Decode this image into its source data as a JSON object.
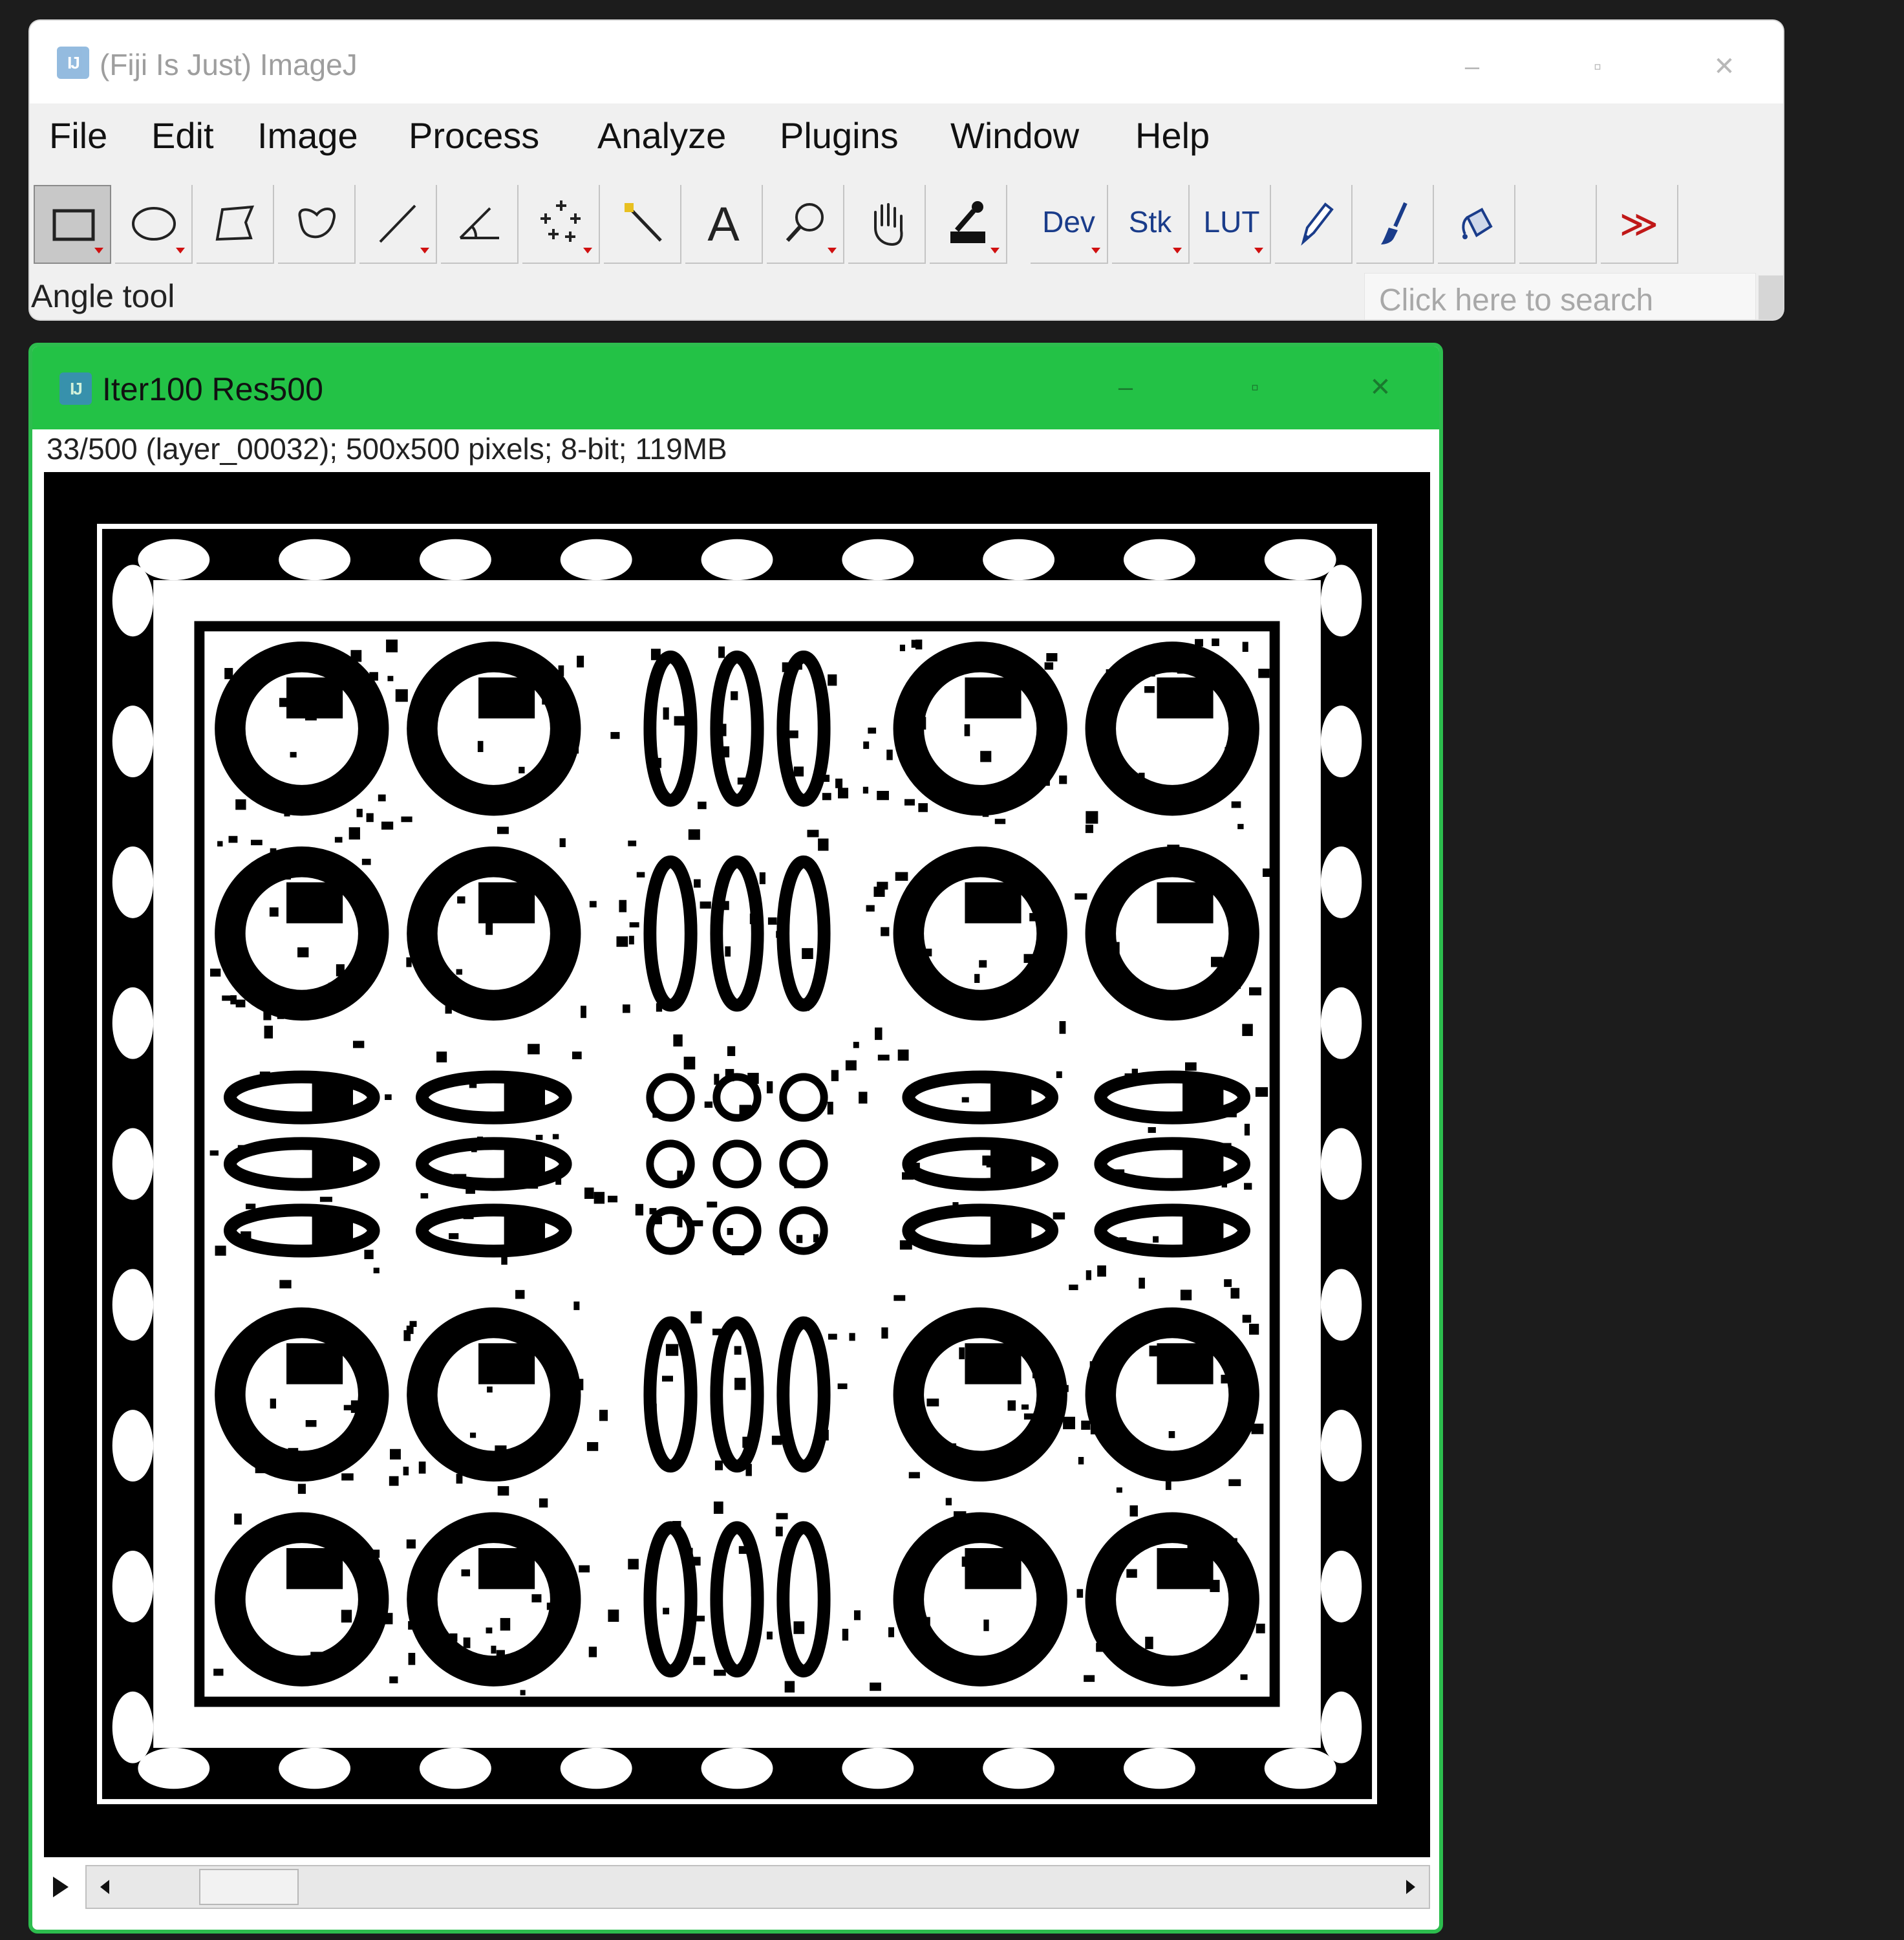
{
  "main_window": {
    "title": "(Fiji Is Just) ImageJ",
    "icon": "imagej-logo-icon",
    "controls": {
      "minimize": "–",
      "maximize": "▫",
      "close": "✕"
    }
  },
  "menubar": {
    "items": [
      "File",
      "Edit",
      "Image",
      "Process",
      "Analyze",
      "Plugins",
      "Window",
      "Help"
    ]
  },
  "toolbar": {
    "tools": [
      {
        "name": "rectangle",
        "icon": "rectangle-icon",
        "selected": true,
        "dropdown": true
      },
      {
        "name": "oval",
        "icon": "oval-icon",
        "dropdown": true
      },
      {
        "name": "polygon",
        "icon": "polygon-icon"
      },
      {
        "name": "freehand",
        "icon": "freehand-icon"
      },
      {
        "name": "line",
        "icon": "line-icon",
        "dropdown": true
      },
      {
        "name": "angle",
        "icon": "angle-icon"
      },
      {
        "name": "multipoint",
        "icon": "multipoint-icon",
        "dropdown": true
      },
      {
        "name": "wand",
        "icon": "wand-icon"
      },
      {
        "name": "text",
        "icon": "text-icon",
        "label": "A"
      },
      {
        "name": "zoom",
        "icon": "magnifier-icon",
        "dropdown": true
      },
      {
        "name": "hand",
        "icon": "hand-icon"
      },
      {
        "name": "color-picker",
        "icon": "eyedropper-icon",
        "dropdown": true
      },
      {
        "name": "dev",
        "label": "Dev",
        "dropdown": true
      },
      {
        "name": "stk",
        "label": "Stk",
        "dropdown": true
      },
      {
        "name": "lut",
        "label": "LUT",
        "dropdown": true
      },
      {
        "name": "pencil",
        "icon": "pencil-icon"
      },
      {
        "name": "brush",
        "icon": "brush-icon"
      },
      {
        "name": "flood-fill",
        "icon": "bucket-icon"
      },
      {
        "name": "empty",
        "icon": ""
      },
      {
        "name": "more",
        "label": "≫"
      }
    ]
  },
  "status": {
    "text": "Angle tool"
  },
  "search": {
    "placeholder": "Click here to search"
  },
  "image_window": {
    "title": "Iter100 Res500",
    "info": "33/500 (layer_00032); 500x500 pixels; 8-bit; 119MB",
    "border_color": "#23c246",
    "controls": {
      "minimize": "–",
      "maximize": "▫",
      "close": "✕"
    }
  },
  "stack_slider": {
    "slice": 33,
    "total": 500
  },
  "colors": {
    "background": "#1c1c1c",
    "active_title": "#23c246",
    "dropdown_marker": "#d01010",
    "text_button": "#1a3c8a"
  }
}
